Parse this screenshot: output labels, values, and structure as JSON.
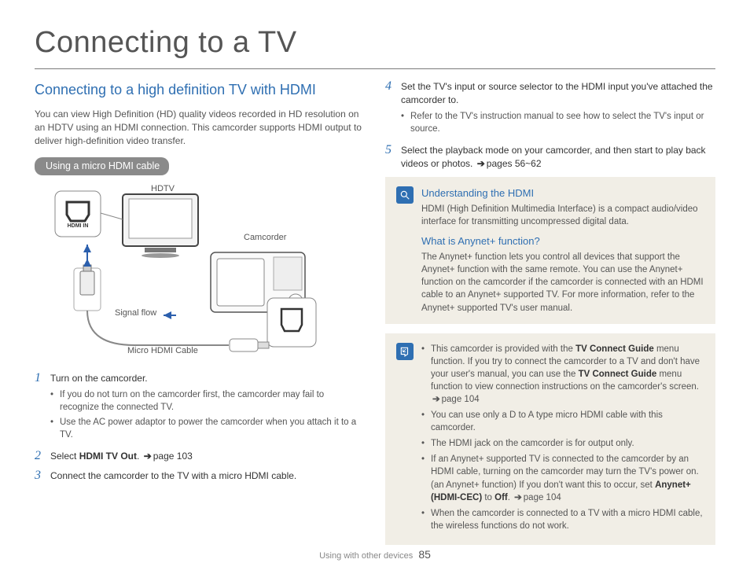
{
  "page_title": "Connecting to a TV",
  "section_title": "Connecting to a high definition TV with HDMI",
  "intro": "You can view High Definition (HD) quality videos recorded in HD resolution on an HDTV using an HDMI connection. This camcorder supports HDMI output to deliver high-definition video transfer.",
  "pill": "Using a micro HDMI cable",
  "diagram": {
    "hdtv": "HDTV",
    "hdmi_in": "HDMI IN",
    "camcorder": "Camcorder",
    "signal_flow": "Signal flow",
    "micro_hdmi": "Micro HDMI Cable"
  },
  "steps_left": [
    {
      "num": "1",
      "text": "Turn on the camcorder.",
      "subs": [
        "If you do not turn on the camcorder first, the camcorder may fail to recognize the connected TV.",
        "Use the AC power adaptor to power the camcorder when you attach it to a TV."
      ]
    },
    {
      "num": "2",
      "text_pre": "Select ",
      "text_bold": "HDMI TV Out",
      "text_post": ". ",
      "ref": "page 103"
    },
    {
      "num": "3",
      "text": "Connect the camcorder to the TV with a micro HDMI cable."
    }
  ],
  "steps_right": [
    {
      "num": "4",
      "text": "Set the TV's input or source selector to the HDMI input you've attached the camcorder to.",
      "subs": [
        "Refer to the TV's instruction manual to see how to select the TV's input or source."
      ]
    },
    {
      "num": "5",
      "text": "Select the playback mode on your camcorder, and then start to play back videos or photos. ",
      "ref": "pages 56~62"
    }
  ],
  "info1": {
    "h1": "Understanding the HDMI",
    "p1": "HDMI (High Definition Multimedia Interface) is a compact audio/video interface for transmitting uncompressed digital data.",
    "h2": "What is Anynet+ function?",
    "p2": "The Anynet+ function lets you control all devices that support the Anynet+ function with the same remote. You can use the Anynet+ function on the camcorder if the camcorder is connected with an HDMI cable to an Anynet+ supported TV. For more information, refer to the Anynet+ supported TV's user manual."
  },
  "info2": {
    "b1_a": "This camcorder is provided with the ",
    "b1_b": "TV Connect Guide",
    "b1_c": " menu function. If you try to connect the camcorder to a TV and don't have your user's manual, you can use the ",
    "b1_d": "TV Connect Guide",
    "b1_e": " menu function to view connection instructions on the camcorder's screen. ",
    "b1_ref": "page 104",
    "b2": "You can use only a D to A type micro HDMI cable with this camcorder.",
    "b3": "The HDMI jack on the camcorder is for output only.",
    "b4_a": "If an Anynet+ supported TV is connected to the camcorder by an HDMI cable, turning on the camcorder may turn the TV's power on. (an Anynet+ function) If you don't want this to occur, set ",
    "b4_b": "Anynet+ (HDMI-CEC)",
    "b4_c": " to ",
    "b4_d": "Off",
    "b4_e": ". ",
    "b4_ref": "page 104",
    "b5": "When the camcorder is connected to a TV with a micro HDMI cable, the wireless functions do not work."
  },
  "footer": {
    "section": "Using with other devices",
    "page": "85"
  }
}
